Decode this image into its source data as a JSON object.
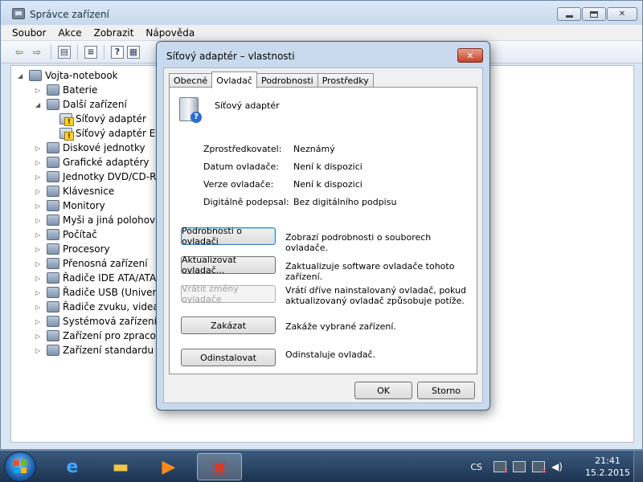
{
  "window": {
    "title": "Správce zařízení"
  },
  "menu": [
    "Soubor",
    "Akce",
    "Zobrazit",
    "Nápověda"
  ],
  "toolbar_icons": [
    "back-icon",
    "forward-icon",
    "tree-view-icon",
    "properties-icon",
    "help-icon",
    "scan-icon"
  ],
  "tree": {
    "root": "Vojta-notebook",
    "items": [
      {
        "label": "Baterie",
        "icon": "battery-icon",
        "expander": "▷",
        "level": 1
      },
      {
        "label": "Další zařízení",
        "icon": "other-devices-icon",
        "expander": "◢",
        "level": 1
      },
      {
        "label": "Síťový adaptér",
        "icon": "unknown-device-warning-icon",
        "expander": "",
        "level": 2,
        "warn": true
      },
      {
        "label": "Síťový adaptér Ethe",
        "icon": "unknown-device-warning-icon",
        "expander": "",
        "level": 2,
        "warn": true
      },
      {
        "label": "Diskové jednotky",
        "icon": "disk-drive-icon",
        "expander": "▷",
        "level": 1
      },
      {
        "label": "Grafické adaptéry",
        "icon": "display-adapter-icon",
        "expander": "▷",
        "level": 1
      },
      {
        "label": "Jednotky DVD/CD-ROM",
        "icon": "dvd-drive-icon",
        "expander": "▷",
        "level": 1
      },
      {
        "label": "Klávesnice",
        "icon": "keyboard-icon",
        "expander": "▷",
        "level": 1
      },
      {
        "label": "Monitory",
        "icon": "monitor-icon",
        "expander": "▷",
        "level": 1
      },
      {
        "label": "Myši a jiná polohovací",
        "icon": "mouse-icon",
        "expander": "▷",
        "level": 1
      },
      {
        "label": "Počítač",
        "icon": "computer-icon",
        "expander": "▷",
        "level": 1
      },
      {
        "label": "Procesory",
        "icon": "processor-icon",
        "expander": "▷",
        "level": 1
      },
      {
        "label": "Přenosná zařízení",
        "icon": "portable-device-icon",
        "expander": "▷",
        "level": 1
      },
      {
        "label": "Řadiče IDE ATA/ATAPI",
        "icon": "ide-controller-icon",
        "expander": "▷",
        "level": 1
      },
      {
        "label": "Řadiče USB (Universal",
        "icon": "usb-controller-icon",
        "expander": "▷",
        "level": 1
      },
      {
        "label": "Řadiče zvuku, videa a h",
        "icon": "sound-controller-icon",
        "expander": "▷",
        "level": 1
      },
      {
        "label": "Systémová zařízení",
        "icon": "system-device-icon",
        "expander": "▷",
        "level": 1
      },
      {
        "label": "Zařízení pro zpracován",
        "icon": "imaging-device-icon",
        "expander": "▷",
        "level": 1
      },
      {
        "label": "Zařízení standardu HID",
        "icon": "hid-device-icon",
        "expander": "▷",
        "level": 1
      }
    ]
  },
  "dialog": {
    "title": "Síťový adaptér – vlastnosti",
    "close": "✕",
    "tabs": [
      "Obecné",
      "Ovladač",
      "Podrobnosti",
      "Prostředky"
    ],
    "active_tab": 1,
    "device_name": "Síťový adaptér",
    "info": [
      {
        "label": "Zprostředkovatel:",
        "value": "Neznámý"
      },
      {
        "label": "Datum ovladače:",
        "value": "Není k dispozici"
      },
      {
        "label": "Verze ovladače:",
        "value": "Není k dispozici"
      },
      {
        "label": "Digitálně podepsal:",
        "value": "Bez digitálního podpisu"
      }
    ],
    "buttons": [
      {
        "label": "Podrobnosti o ovladači",
        "desc": "Zobrazí podrobnosti o souborech ovladače.",
        "enabled": true,
        "focused": true
      },
      {
        "label": "Aktualizovat ovladač...",
        "desc": "Zaktualizuje software ovladače tohoto zařízení.",
        "enabled": true
      },
      {
        "label": "Vrátit změny ovladače",
        "desc": "Vrátí dříve nainstalovaný ovladač, pokud aktualizovaný ovladač způsobuje potíže.",
        "enabled": false
      },
      {
        "label": "Zakázat",
        "desc": "Zakáže vybrané zařízení.",
        "enabled": true
      },
      {
        "label": "Odinstalovat",
        "desc": "Odinstaluje ovladač.",
        "enabled": true
      }
    ],
    "ok": "OK",
    "cancel": "Storno"
  },
  "taskbar": {
    "apps": [
      "internet-explorer-icon",
      "windows-explorer-icon",
      "media-player-icon",
      "device-manager-icon"
    ],
    "language": "CS",
    "time": "21:41",
    "date": "15.2.2015"
  },
  "colors": {
    "accent": "#3c7fb1",
    "taskbar": "#1c3350",
    "warning": "#ffd22b"
  }
}
